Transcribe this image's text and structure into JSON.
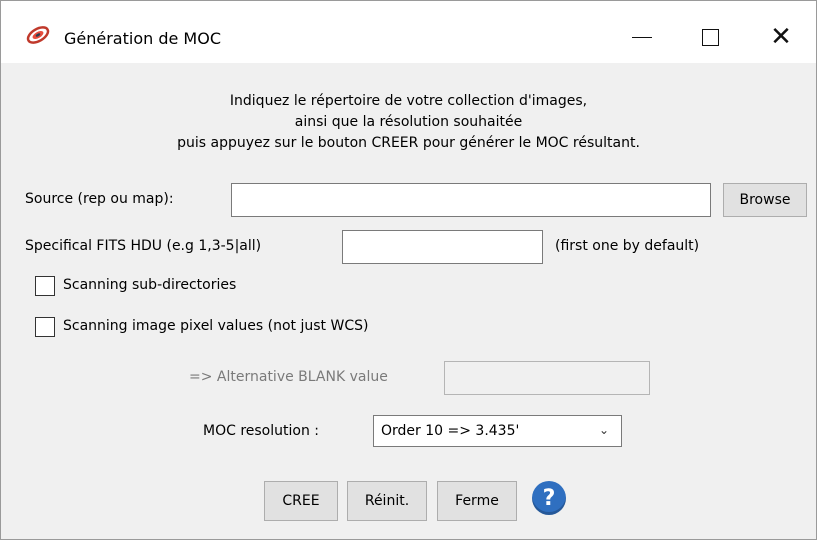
{
  "window": {
    "title": "Génération de MOC",
    "minimize": "minimize",
    "maximize": "maximize",
    "close": "✕"
  },
  "intro": {
    "line1": "Indiquez le répertoire de votre collection d'images,",
    "line2": "ainsi que la résolution souhaitée",
    "line3": "puis appuyez sur le bouton CREER pour générer le MOC résultant."
  },
  "source": {
    "label": "Source (rep ou map):",
    "value": "",
    "browse": "Browse"
  },
  "hdu": {
    "label": "Specifical FITS HDU (e.g 1,3-5|all)",
    "value": "",
    "hint": "(first one by default)"
  },
  "options": {
    "scan_subdirs": {
      "label": "Scanning sub-directories",
      "checked": false
    },
    "scan_pixels": {
      "label": "Scanning image pixel values (not just WCS)",
      "checked": false
    }
  },
  "blank": {
    "label": "=> Alternative BLANK value",
    "value": ""
  },
  "resolution": {
    "label": "MOC resolution :",
    "selected": "Order 10 => 3.435'"
  },
  "buttons": {
    "create": "CREE",
    "reset": "Réinit.",
    "close": "Ferme",
    "help": "?"
  },
  "colors": {
    "help_icon": "#2f6fc0",
    "window_bg": "#f0f0f0"
  }
}
